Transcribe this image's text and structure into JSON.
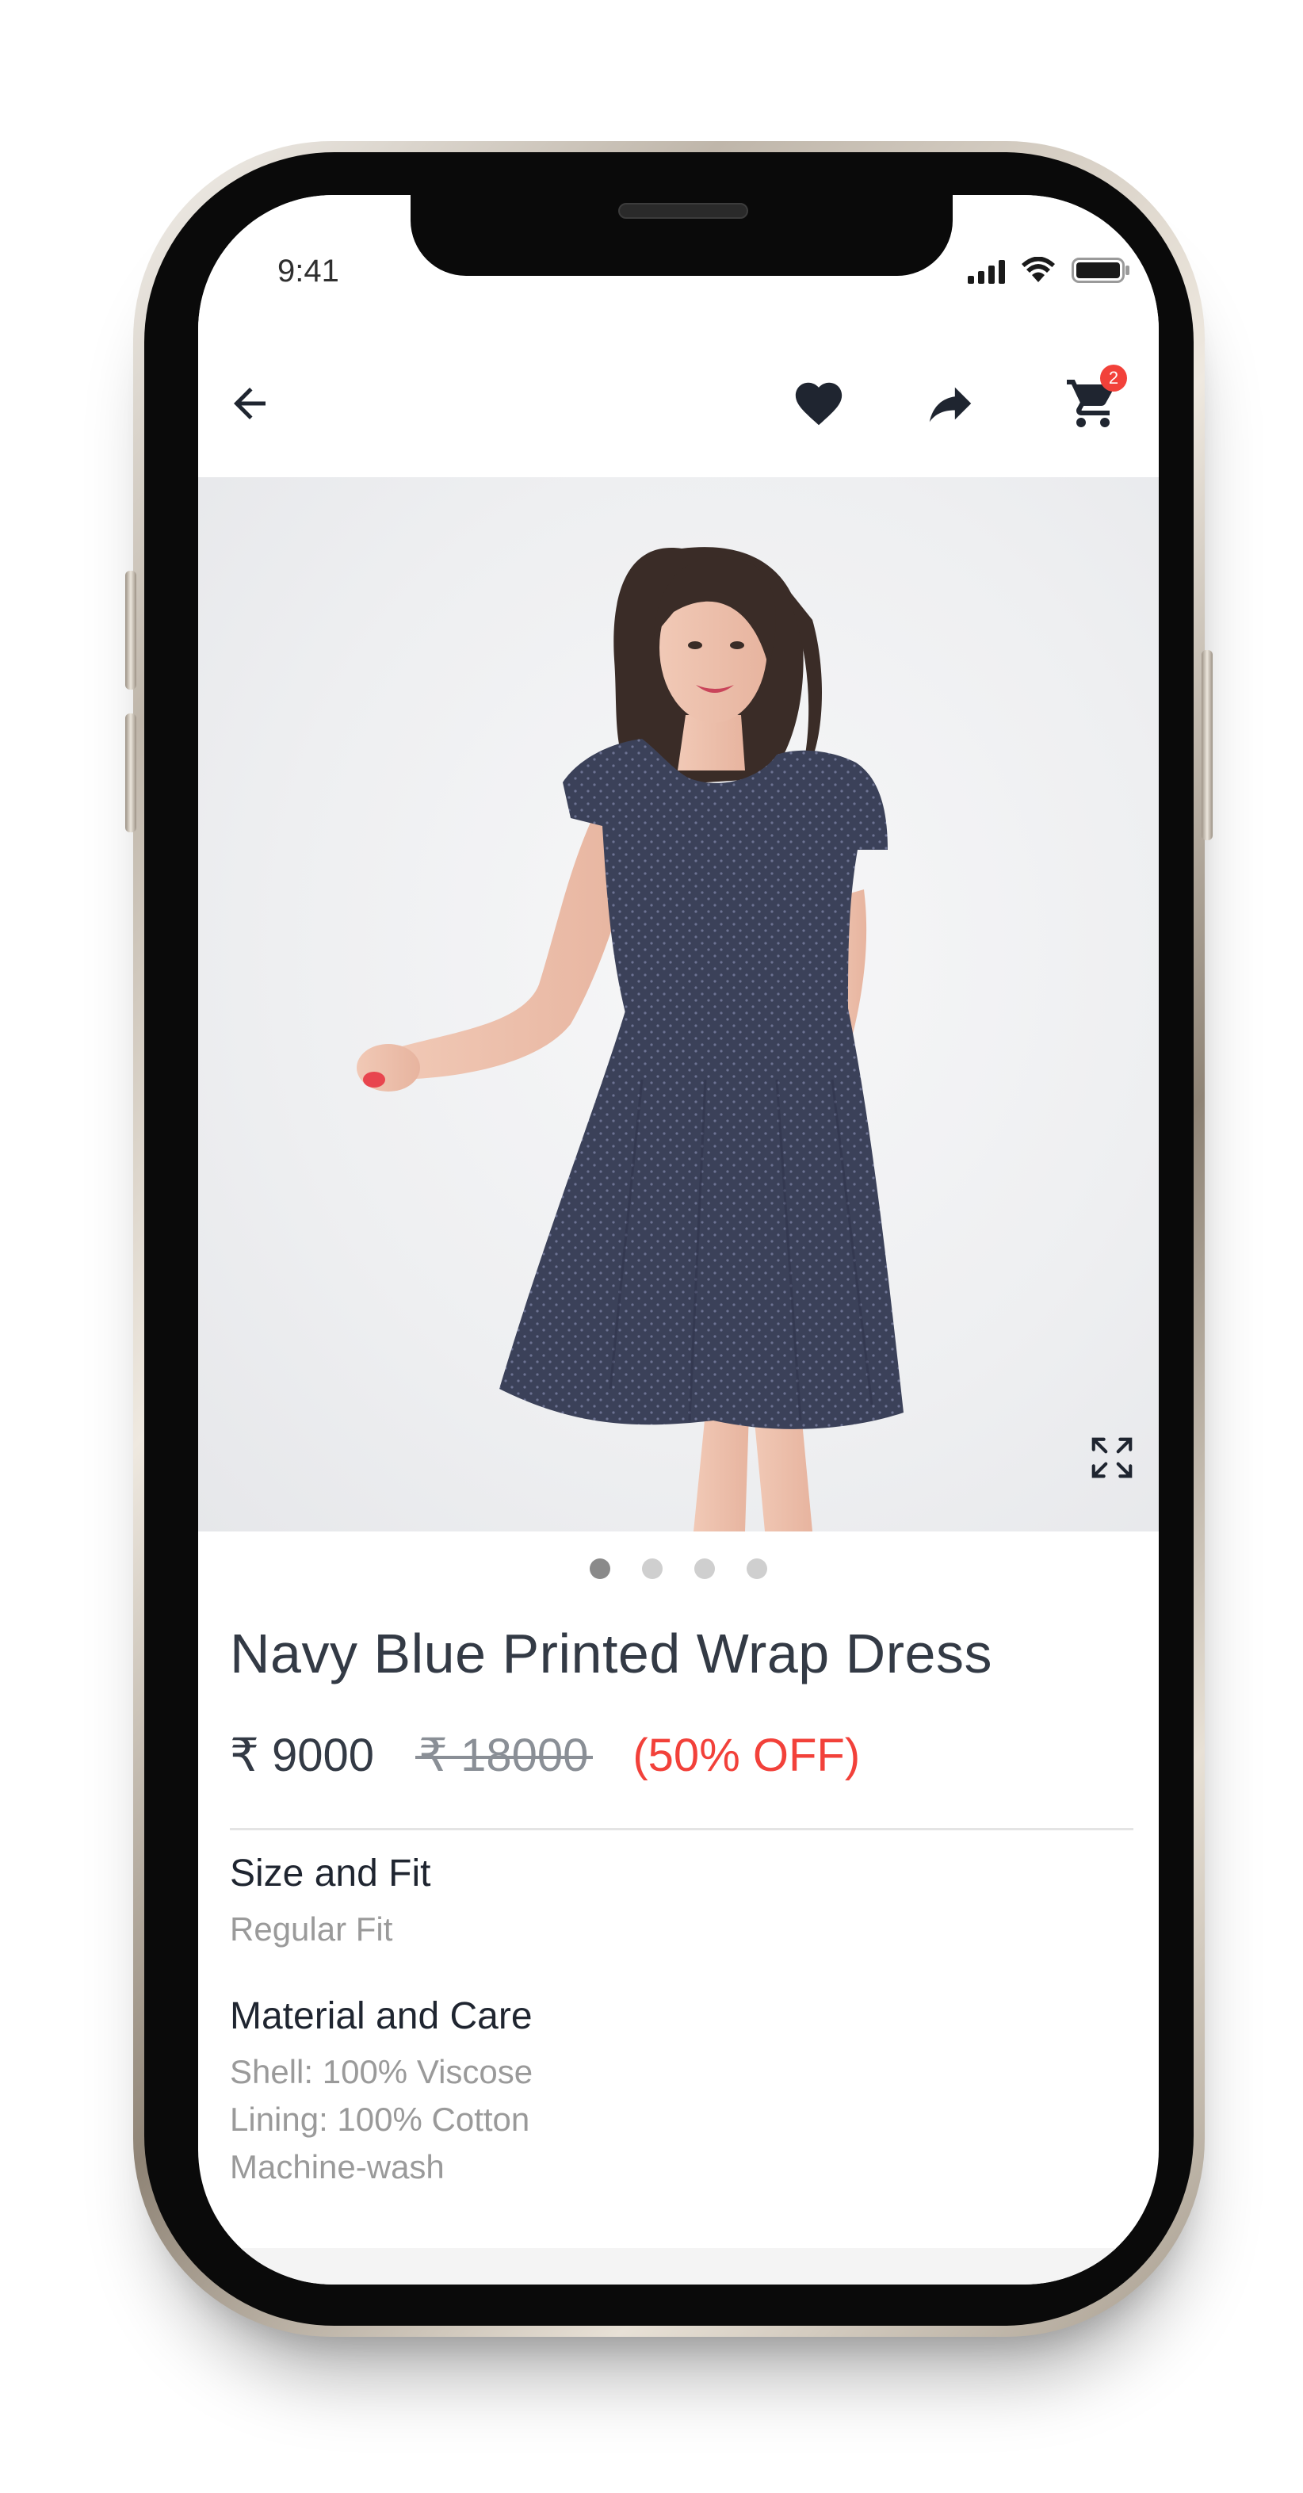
{
  "status_bar": {
    "time": "9:41",
    "icons": [
      "signal-icon",
      "wifi-icon",
      "battery-icon"
    ]
  },
  "app_bar": {
    "icons": [
      "back-arrow-icon",
      "heart-icon",
      "share-icon",
      "cart-icon"
    ],
    "cart_badge_count": "2"
  },
  "gallery": {
    "image_count": 4,
    "active_index": 0,
    "expand_icon": "expand-icon"
  },
  "product": {
    "title": "Navy Blue Printed Wrap Dress",
    "price": "₹ 9000",
    "mrp": "₹ 18000",
    "discount": "(50% OFF)"
  },
  "size_and_fit": {
    "heading": "Size and Fit",
    "value": "Regular Fit"
  },
  "material_and_care": {
    "heading": "Material and Care",
    "lines": [
      "Shell: 100% Viscose",
      "Lining: 100% Cotton",
      "Machine-wash"
    ]
  },
  "colors": {
    "accent_red": "#f2413a",
    "text_dark": "#333a45",
    "text_muted": "#9a9a9a",
    "dress_navy": "#3b4159"
  }
}
